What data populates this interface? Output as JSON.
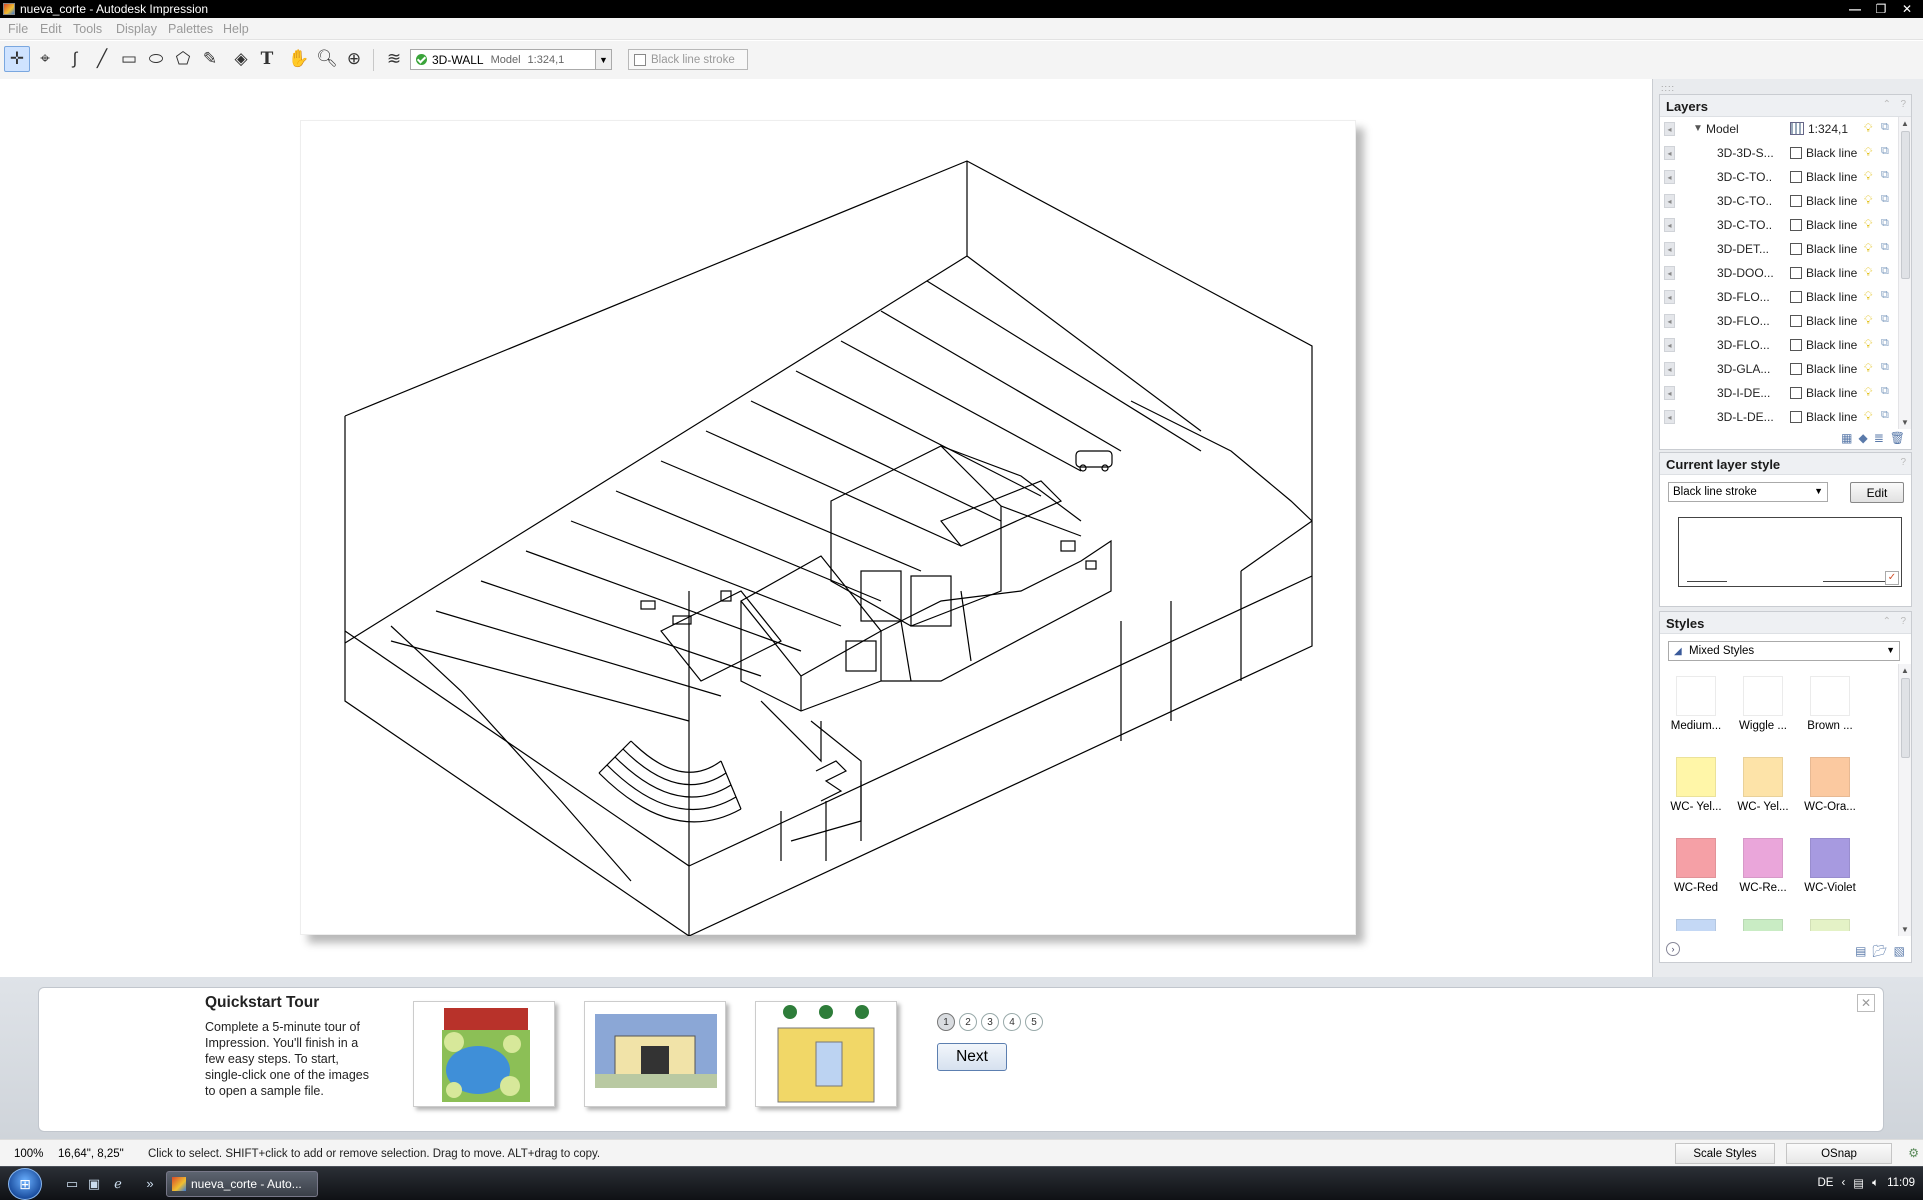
{
  "window": {
    "title": "nueva_corte - Autodesk Impression",
    "controls": [
      "—",
      "❐",
      "✕"
    ]
  },
  "menu": [
    "File",
    "Edit",
    "Tools",
    "Display",
    "Palettes",
    "Help"
  ],
  "toolbar": {
    "layer_name": "3D-WALL",
    "layer_space": "Model",
    "layer_scale": "1:324,1",
    "style_name": "Black line stroke"
  },
  "layers_panel": {
    "title": "Layers",
    "model": {
      "name": "Model",
      "scale": "1:324,1"
    },
    "rows": [
      {
        "name": "3D-3D-S...",
        "style": "Black line..."
      },
      {
        "name": "3D-C-TO...",
        "style": "Black line..."
      },
      {
        "name": "3D-C-TO...",
        "style": "Black line..."
      },
      {
        "name": "3D-C-TO...",
        "style": "Black line..."
      },
      {
        "name": "3D-DET...",
        "style": "Black line..."
      },
      {
        "name": "3D-DOO...",
        "style": "Black line..."
      },
      {
        "name": "3D-FLO...",
        "style": "Black line..."
      },
      {
        "name": "3D-FLO...",
        "style": "Black line..."
      },
      {
        "name": "3D-FLO...",
        "style": "Black line..."
      },
      {
        "name": "3D-GLA...",
        "style": "Black line..."
      },
      {
        "name": "3D-I-DE...",
        "style": "Black line..."
      },
      {
        "name": "3D-L-DE...",
        "style": "Black line..."
      }
    ]
  },
  "current_layer_style": {
    "title": "Current layer style",
    "selected": "Black line stroke",
    "edit_label": "Edit"
  },
  "styles_panel": {
    "title": "Styles",
    "selected": "Mixed Styles",
    "tiles": [
      {
        "label": "Medium...",
        "color": "#ffffff"
      },
      {
        "label": "Wiggle ...",
        "color": "#ffffff"
      },
      {
        "label": "Brown ...",
        "color": "#ffffff"
      },
      {
        "label": "WC- Yel...",
        "color": "#fff6a8"
      },
      {
        "label": "WC- Yel...",
        "color": "#fde3a8"
      },
      {
        "label": "WC-Ora...",
        "color": "#fbc9a0"
      },
      {
        "label": "WC-Red",
        "color": "#f5a0a6"
      },
      {
        "label": "WC-Re...",
        "color": "#eaa6da"
      },
      {
        "label": "WC-Violet",
        "color": "#a79ae0"
      }
    ],
    "partial_tile_colors": [
      "#c4d8f5",
      "#c9ecc4",
      "#e4f2c6"
    ]
  },
  "quickstart": {
    "title": "Quickstart Tour",
    "text": "Complete a 5-minute tour of Impression. You'll finish in a few easy steps. To start, single-click one of the images to open a sample file.",
    "steps": [
      "1",
      "2",
      "3",
      "4",
      "5"
    ],
    "next_label": "Next"
  },
  "status": {
    "zoom": "100%",
    "coords": "16,64\", 8,25\"",
    "hint": "Click to select. SHIFT+click to add or remove selection. Drag to move. ALT+drag to copy.",
    "scale_styles": "Scale Styles",
    "osnap": "OSnap"
  },
  "taskbar": {
    "task_label": "nueva_corte - Auto...",
    "lang": "DE",
    "time": "11:09"
  }
}
